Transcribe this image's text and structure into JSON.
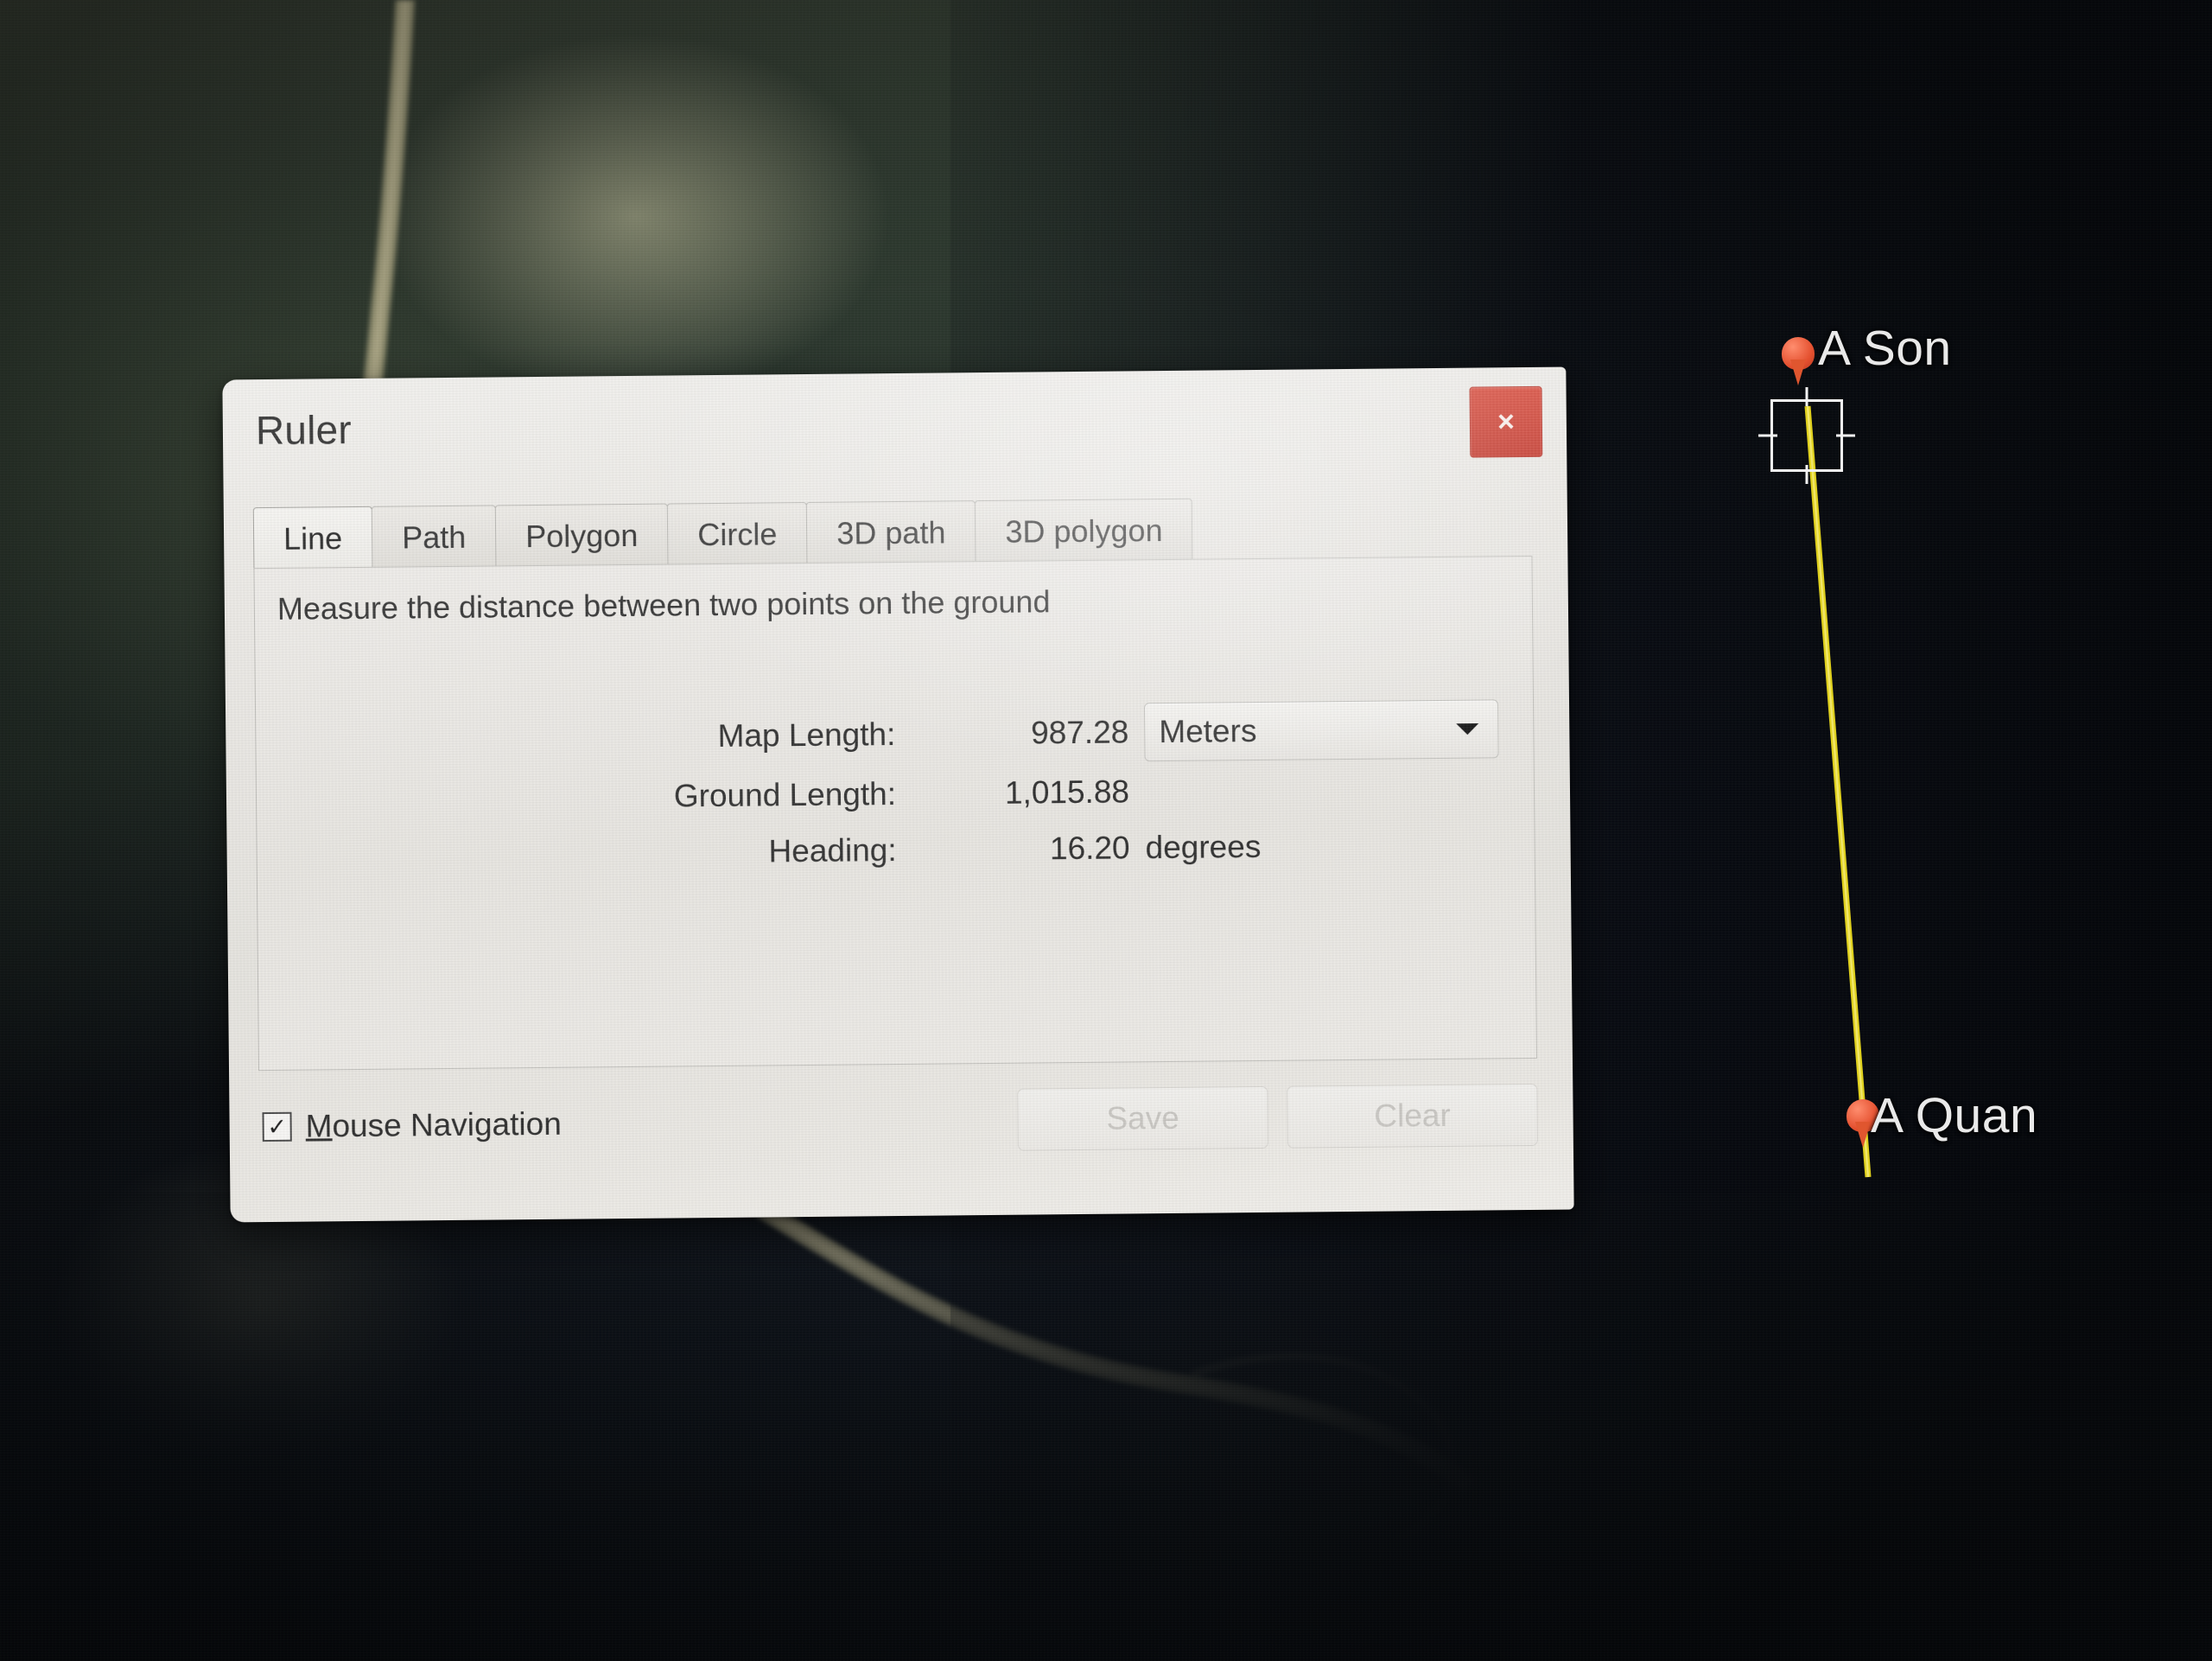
{
  "app": {
    "map_type": "satellite-imagery"
  },
  "dialog": {
    "title": "Ruler",
    "close_label": "×",
    "close_icon": "close-icon",
    "accent_red": "#cc4433",
    "tabs": [
      {
        "label": "Line",
        "active": true
      },
      {
        "label": "Path",
        "active": false
      },
      {
        "label": "Polygon",
        "active": false
      },
      {
        "label": "Circle",
        "active": false
      },
      {
        "label": "3D path",
        "active": false
      },
      {
        "label": "3D polygon",
        "active": false
      }
    ],
    "description": "Measure the distance between two points on the ground",
    "measurements": [
      {
        "label": "Map Length:",
        "value": "987.28",
        "unit": "",
        "has_select": true
      },
      {
        "label": "Ground Length:",
        "value": "1,015.88",
        "unit": "",
        "has_select": false
      },
      {
        "label": "Heading:",
        "value": "16.20",
        "unit": "degrees",
        "has_select": false
      }
    ],
    "units_select": {
      "selected": "Meters",
      "caret_icon": "chevron-down-icon"
    },
    "mouse_navigation": {
      "label_prefix": "M",
      "label_rest": "ouse Navigation",
      "checked": true,
      "check_glyph": "✓"
    },
    "buttons": [
      {
        "label": "Save",
        "disabled": true
      },
      {
        "label": "Clear",
        "disabled": true
      }
    ]
  },
  "map": {
    "line_color": "#e8d81e",
    "placemarks": [
      {
        "name": "A Son",
        "label": "A Son"
      },
      {
        "name": "A Quan",
        "label": "A Quan"
      }
    ]
  }
}
